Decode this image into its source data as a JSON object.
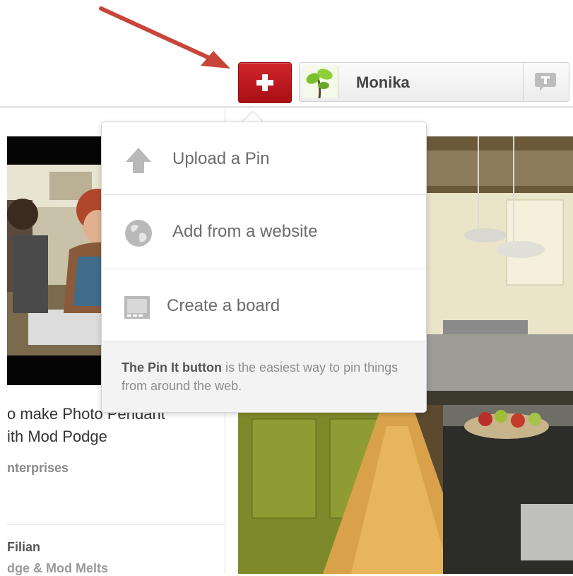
{
  "header": {
    "add_button": {
      "icon": "plus-icon",
      "color": "#c4161c"
    },
    "profile": {
      "user_name": "Monika",
      "avatar_icon": "tree-avatar-icon",
      "notification_icon": "notification-pushpin-icon"
    }
  },
  "annotation": {
    "arrow_icon": "arrow-icon",
    "color": "#c8453a"
  },
  "menu": {
    "items": [
      {
        "label": "Upload a Pin",
        "icon": "up-arrow-icon"
      },
      {
        "label": "Add from a website",
        "icon": "globe-icon"
      },
      {
        "label": "Create a board",
        "icon": "board-icon"
      }
    ],
    "footer": {
      "bold": "The Pin It button",
      "text": " is the easiest way to pin things from around the web."
    }
  },
  "left_pin": {
    "title": "o make Photo Pendant\nith Mod Podge",
    "source": "nterprises",
    "user": "Filian",
    "board": "dge & Mod Melts"
  }
}
